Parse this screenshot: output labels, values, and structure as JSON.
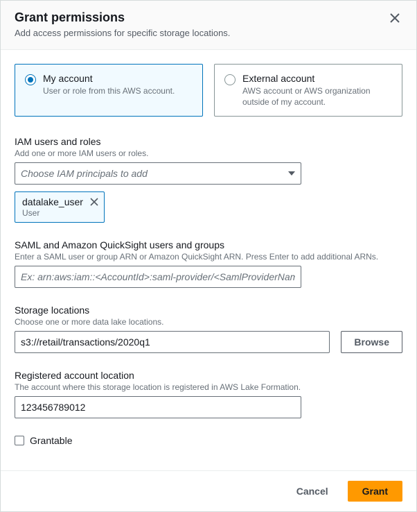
{
  "header": {
    "title": "Grant permissions",
    "subtitle": "Add access permissions for specific storage locations."
  },
  "account_tiles": [
    {
      "title": "My account",
      "desc": "User or role from this AWS account.",
      "selected": true
    },
    {
      "title": "External account",
      "desc": "AWS account or AWS organization outside of my account.",
      "selected": false
    }
  ],
  "iam": {
    "label": "IAM users and roles",
    "help": "Add one or more IAM users or roles.",
    "placeholder": "Choose IAM principals to add",
    "tokens": [
      {
        "name": "datalake_user",
        "type": "User"
      }
    ]
  },
  "saml": {
    "label": "SAML and Amazon QuickSight users and groups",
    "help": "Enter a SAML user or group ARN or Amazon QuickSight ARN. Press Enter to add additional ARNs.",
    "placeholder": "Ex: arn:aws:iam::<AccountId>:saml-provider/<SamlProviderName>",
    "value": ""
  },
  "storage": {
    "label": "Storage locations",
    "help": "Choose one or more data lake locations.",
    "value": "s3://retail/transactions/2020q1",
    "browse_label": "Browse"
  },
  "registered": {
    "label": "Registered account location",
    "help": "The account where this storage location is registered in AWS Lake Formation.",
    "value": "123456789012"
  },
  "grantable": {
    "label": "Grantable",
    "checked": false
  },
  "footer": {
    "cancel": "Cancel",
    "grant": "Grant"
  }
}
